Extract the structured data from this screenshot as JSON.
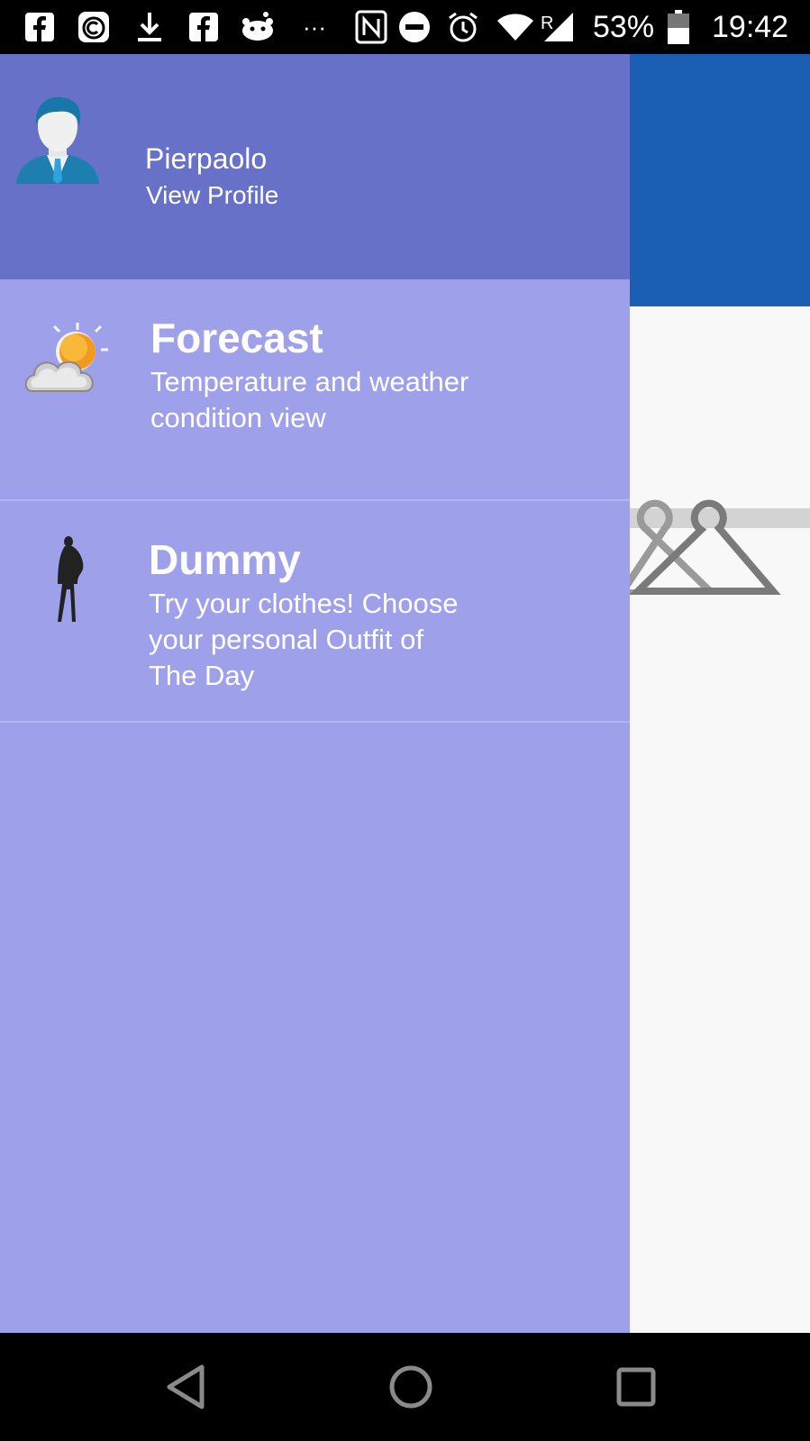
{
  "status_bar": {
    "battery": "53%",
    "time": "19:42",
    "overflow": "···",
    "roaming": "R",
    "icons": [
      "facebook-icon",
      "copyright-icon",
      "download-icon",
      "facebook-icon",
      "reddit-icon",
      "nfc-icon",
      "do-not-disturb-icon",
      "alarm-icon",
      "wifi-icon",
      "signal-icon",
      "battery-icon"
    ]
  },
  "drawer": {
    "profile": {
      "name": "Pierpaolo",
      "link": "View Profile"
    },
    "items": [
      {
        "title": "Forecast",
        "desc": "Temperature and weather condition view",
        "icon": "weather-icon"
      },
      {
        "title": "Dummy",
        "desc": "Try your clothes! Choose your personal Outfit of The Day",
        "icon": "mannequin-icon"
      }
    ]
  },
  "colors": {
    "drawer_header": "#6771c8",
    "drawer_body": "#9fa0ea",
    "app_toolbar": "#1a5fb4"
  },
  "nav_bar": {
    "icons": [
      "back-icon",
      "home-icon",
      "recents-icon"
    ]
  }
}
